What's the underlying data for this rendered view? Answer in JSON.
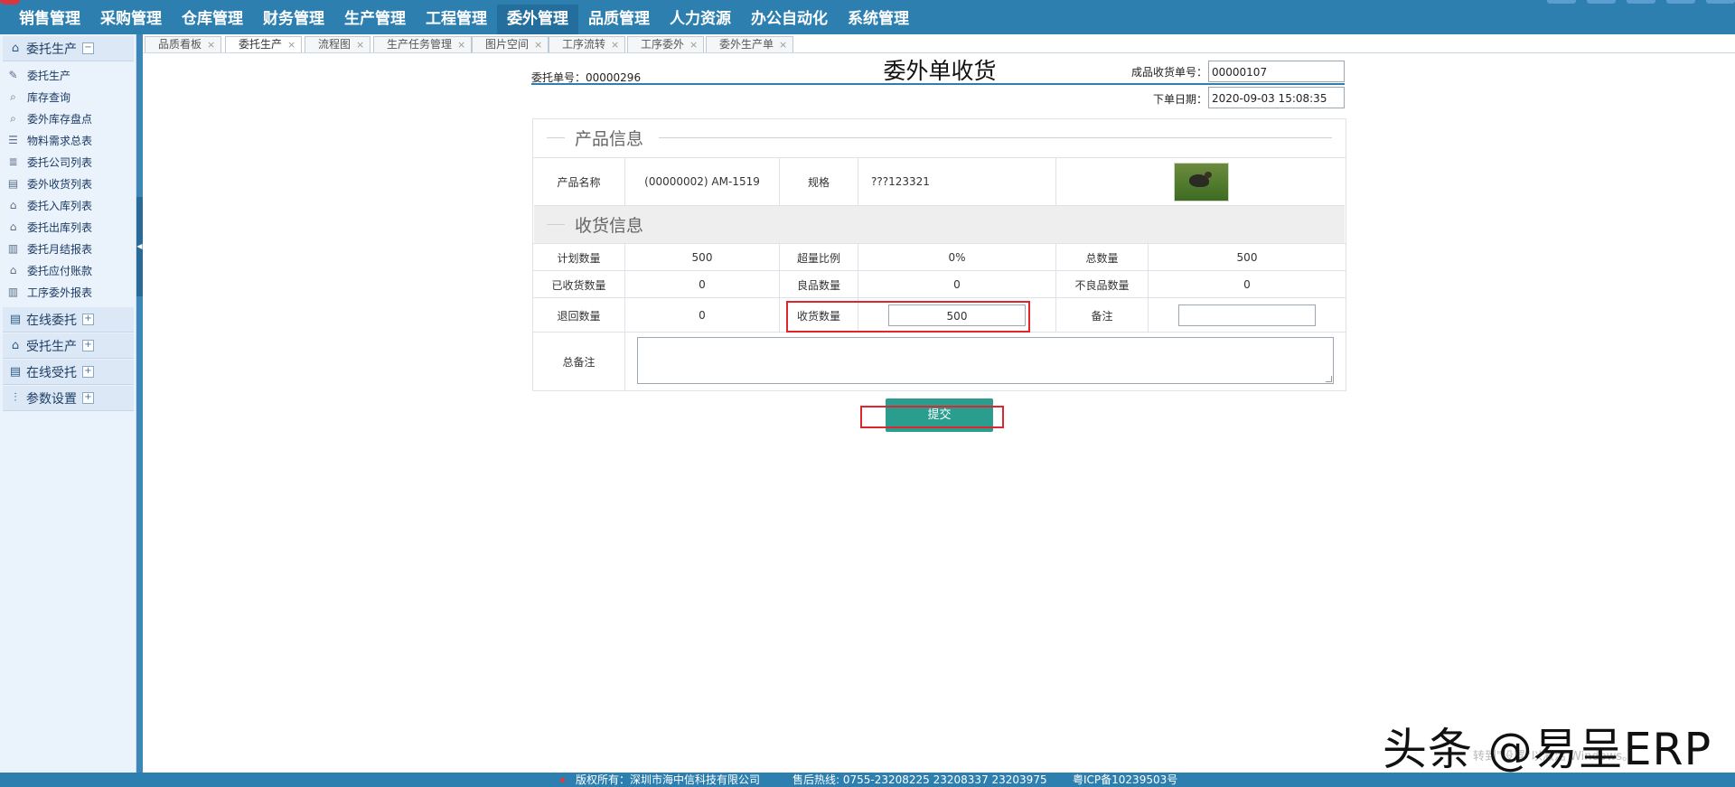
{
  "nav": {
    "items": [
      "销售管理",
      "采购管理",
      "仓库管理",
      "财务管理",
      "生产管理",
      "工程管理",
      "委外管理",
      "品质管理",
      "人力资源",
      "办公自动化",
      "系统管理"
    ],
    "active_index": 6,
    "accent_color": "#2d7fb0"
  },
  "sidebar": {
    "groups": [
      {
        "label": "委托生产",
        "icon": "factory-icon",
        "toggle": "−"
      },
      {
        "label": "在线委托",
        "icon": "document-stack-icon",
        "toggle": "+"
      },
      {
        "label": "受托生产",
        "icon": "factory-icon",
        "toggle": "+"
      },
      {
        "label": "在线受托",
        "icon": "document-stack-icon",
        "toggle": "+"
      },
      {
        "label": "参数设置",
        "icon": "sliders-icon",
        "toggle": "+"
      }
    ],
    "items": [
      {
        "label": "委托生产",
        "icon": "chart-edit-icon"
      },
      {
        "label": "库存查询",
        "icon": "home-search-icon"
      },
      {
        "label": "委外库存盘点",
        "icon": "inventory-search-icon"
      },
      {
        "label": "物料需求总表",
        "icon": "list-doc-icon"
      },
      {
        "label": "委托公司列表",
        "icon": "company-list-icon"
      },
      {
        "label": "委外收货列表",
        "icon": "receive-list-icon"
      },
      {
        "label": "委托入库列表",
        "icon": "warehouse-in-icon"
      },
      {
        "label": "委托出库列表",
        "icon": "warehouse-out-icon"
      },
      {
        "label": "委托月结报表",
        "icon": "bar-chart-icon"
      },
      {
        "label": "委托应付账款",
        "icon": "bank-icon"
      },
      {
        "label": "工序委外报表",
        "icon": "bar-chart-icon"
      }
    ]
  },
  "tabs": [
    {
      "label": "品质看板",
      "close": "×"
    },
    {
      "label": "委托生产",
      "close": "×"
    },
    {
      "label": "流程图",
      "close": "×"
    },
    {
      "label": "生产任务管理",
      "close": "×"
    },
    {
      "label": "图片空间",
      "close": "×"
    },
    {
      "label": "工序流转",
      "close": "×"
    },
    {
      "label": "工序委外",
      "close": "×"
    },
    {
      "label": "委外生产单",
      "close": "×"
    }
  ],
  "active_tab_index": 1,
  "form": {
    "title": "委外单收货",
    "order_no_text": "委托单号：00000296",
    "receipt_no_label": "成品收货单号：",
    "receipt_no_value": "00000107",
    "date_label": "下单日期：",
    "date_value": "2020-09-03 15:08:35"
  },
  "product_section": {
    "title": "产品信息",
    "name_label": "产品名称",
    "name_value": "(00000002) AM-1519",
    "spec_label": "规格",
    "spec_value": "???123321",
    "image_icon": "product-thumbnail-bird"
  },
  "receive_section": {
    "title": "收货信息",
    "planned_label": "计划数量",
    "planned_value": "500",
    "over_ratio_label": "超量比例",
    "over_ratio_value": "0%",
    "total_label": "总数量",
    "total_value": "500",
    "received_label": "已收货数量",
    "received_value": "0",
    "good_label": "良品数量",
    "good_value": "0",
    "defect_label": "不良品数量",
    "defect_value": "0",
    "return_label": "退回数量",
    "return_value": "0",
    "receive_qty_label": "收货数量",
    "receive_qty_value": "500",
    "remark_label": "备注",
    "remark_value": "",
    "total_remark_label": "总备注",
    "total_remark_value": ""
  },
  "submit_label": "提交",
  "highlight_color": "#e0262d",
  "button_color": "#2a9d8f",
  "footer": {
    "copyright": "版权所有：深圳市海中信科技有限公司",
    "hotline": "售后热线: 0755-23208225  23208337  23203975",
    "icp": "粤ICP备10239503号"
  },
  "watermark": {
    "brand": "头条 @易呈ERP",
    "windows_hint": "转到\"设置\"以激活 Windows。"
  }
}
